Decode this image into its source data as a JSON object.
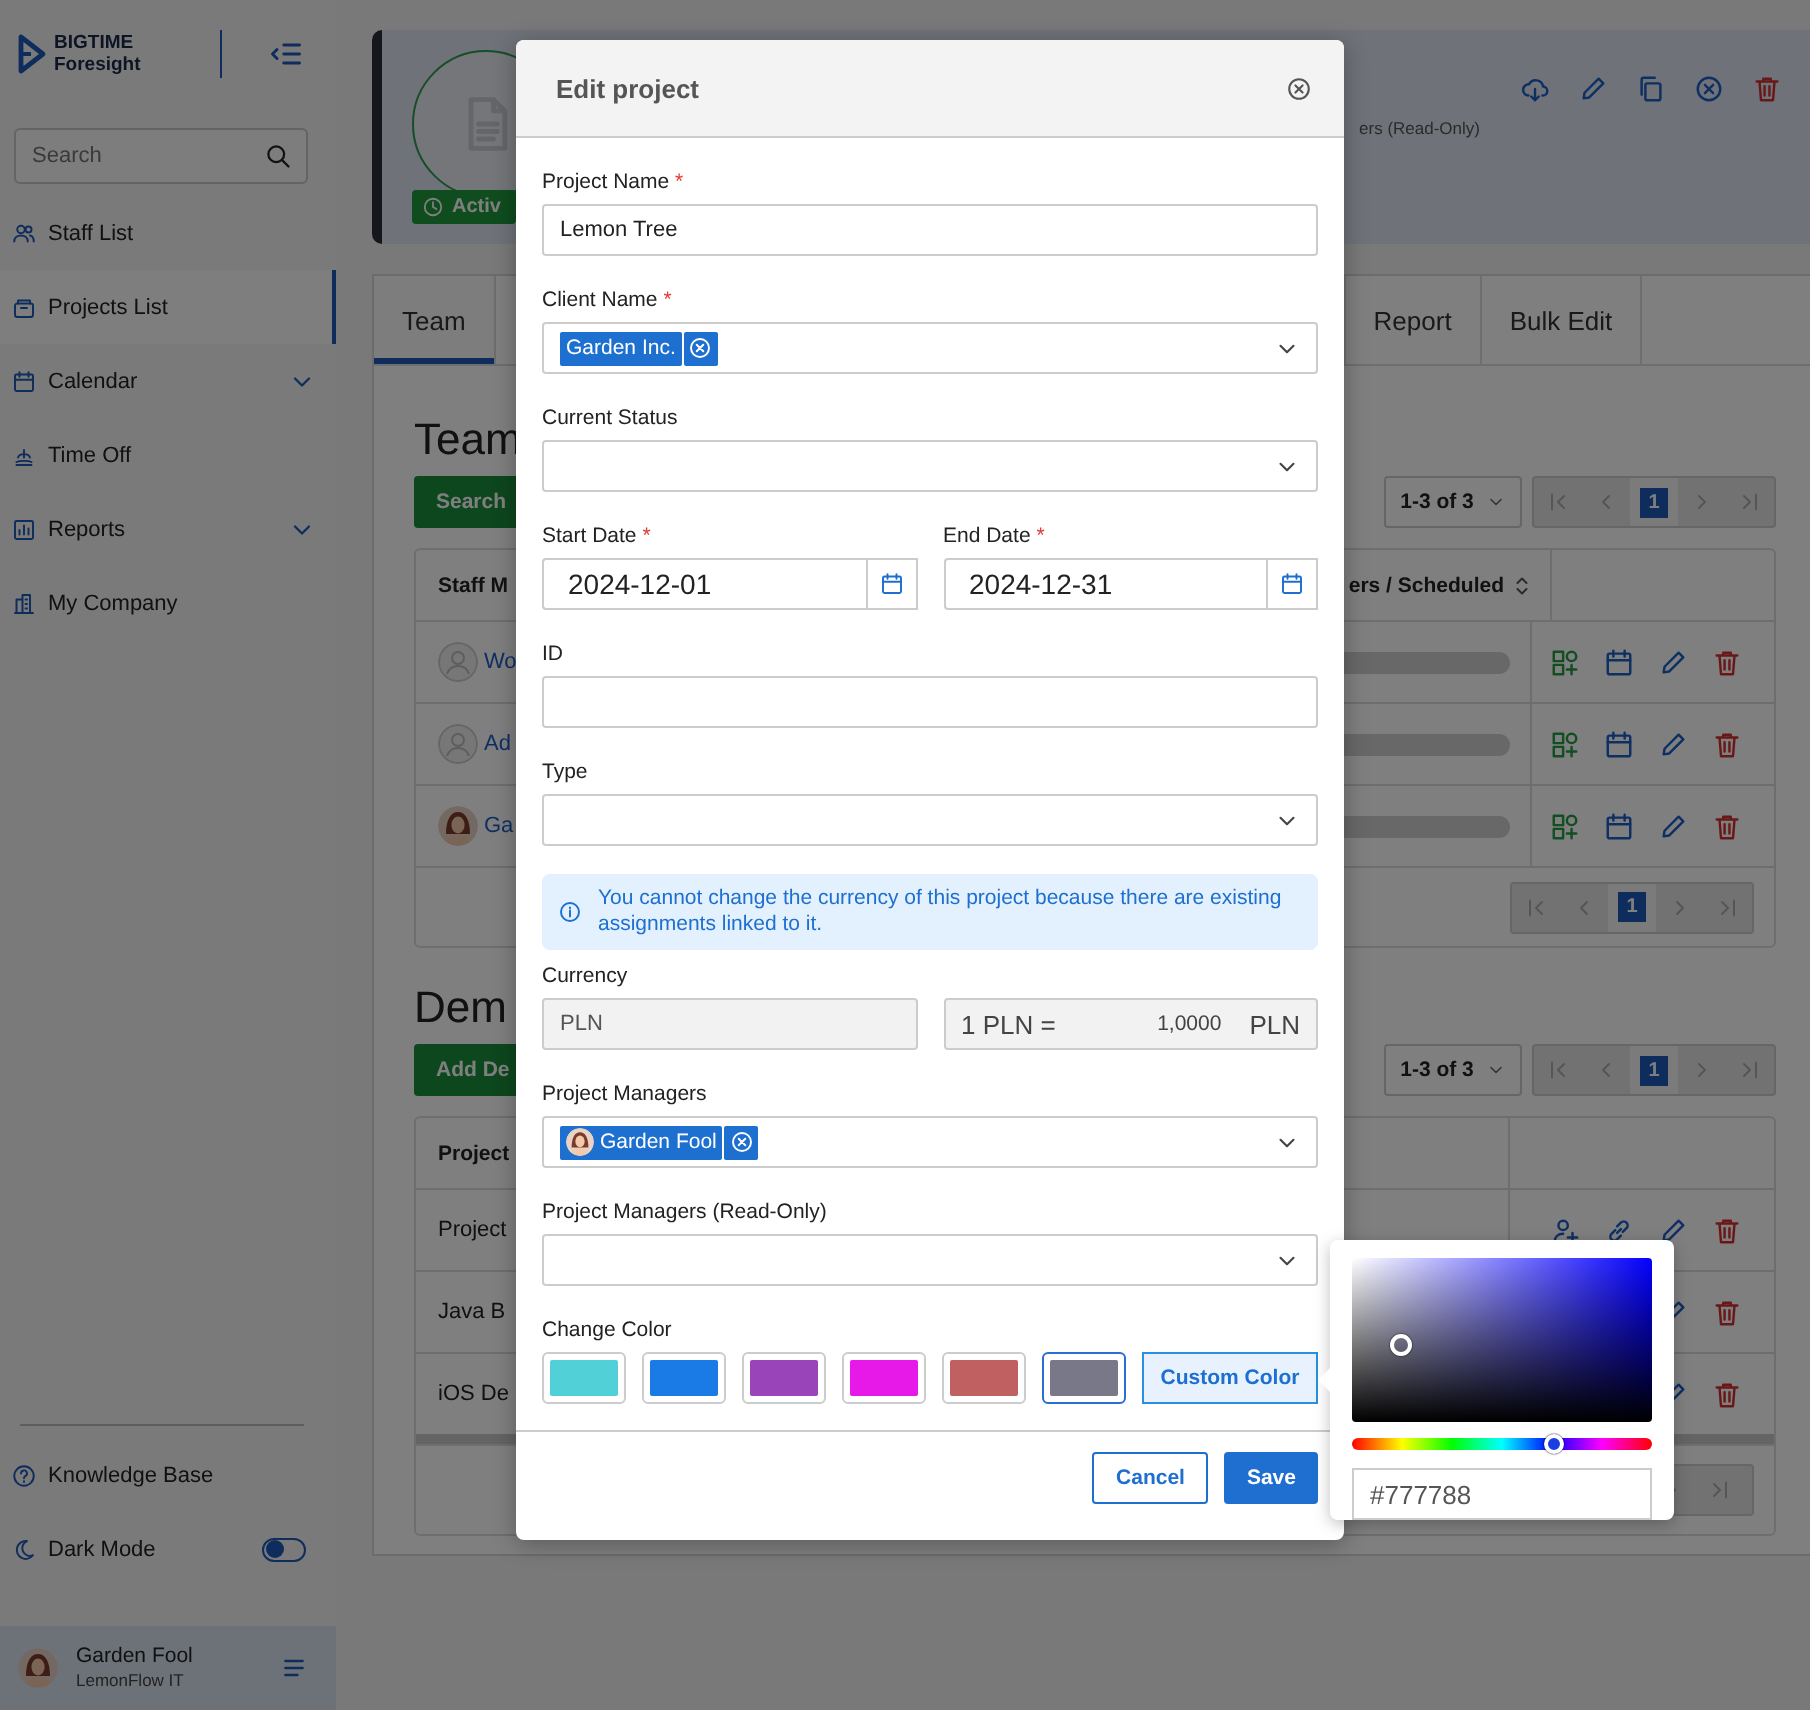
{
  "sidebar": {
    "brand": {
      "name": "BIGTIME",
      "subtitle": "Foresight"
    },
    "search": {
      "placeholder": "Search"
    },
    "nav": [
      {
        "label": "Staff List",
        "selected": false,
        "has_submenu": false
      },
      {
        "label": "Projects List",
        "selected": true,
        "has_submenu": false
      },
      {
        "label": "Calendar",
        "selected": false,
        "has_submenu": true
      },
      {
        "label": "Time Off",
        "selected": false,
        "has_submenu": false
      },
      {
        "label": "Reports",
        "selected": false,
        "has_submenu": true
      },
      {
        "label": "My Company",
        "selected": false,
        "has_submenu": false
      }
    ],
    "help_link": "Knowledge Base",
    "dark_mode": {
      "label": "Dark Mode",
      "on": false
    },
    "user": {
      "name": "Garden Fool",
      "org": "LemonFlow IT"
    }
  },
  "project_header": {
    "status": "Activ",
    "field_label": "ers (Read-Only)"
  },
  "tabs": [
    {
      "label": "Team",
      "selected": true
    },
    {
      "label": "Report",
      "selected": false
    },
    {
      "label": "Bulk Edit",
      "selected": false
    }
  ],
  "team": {
    "heading": "Team",
    "button": "Search",
    "page_range": "1-3 of 3",
    "current_page": "1",
    "columns": [
      "Staff M",
      "ers / Scheduled"
    ],
    "rows": [
      {
        "name": "Wo",
        "kind": "placeholder"
      },
      {
        "name": "Ad",
        "kind": "placeholder"
      },
      {
        "name": "Ga",
        "kind": "photo"
      }
    ],
    "footer_page": "1"
  },
  "demand": {
    "heading": "Dem",
    "button": "Add De",
    "page_range": "1-3 of 3",
    "current_page": "1",
    "columns": [
      "Project"
    ],
    "rows": [
      {
        "name": "Project"
      },
      {
        "name": "Java B"
      },
      {
        "name": "iOS De"
      }
    ]
  },
  "modal": {
    "title": "Edit project",
    "fields": [
      {
        "kind": "text",
        "label": "Project Name",
        "required_mark": "*",
        "value": "Lemon Tree"
      },
      {
        "kind": "select",
        "label": "Client Name",
        "required_mark": "*",
        "chips": [
          {
            "label": "Garden Inc.",
            "avatar": false
          }
        ]
      },
      {
        "kind": "select",
        "label": "Current Status"
      },
      {
        "kind": "dates",
        "items": [
          {
            "label": "Start Date",
            "required_mark": "*",
            "value": "2024-12-01"
          },
          {
            "label": "End Date",
            "required_mark": "*",
            "value": "2024-12-31"
          }
        ]
      },
      {
        "kind": "text",
        "label": "ID"
      },
      {
        "kind": "select",
        "label": "Type"
      },
      {
        "kind": "info",
        "text": "You cannot change the currency of this project because there are existing assignments linked to it."
      },
      {
        "kind": "currency",
        "label": "Currency",
        "value": "PLN",
        "disabled": true,
        "rate_prefix": "1 PLN =",
        "rate": "1,0000",
        "rate_suffix": "PLN"
      },
      {
        "kind": "select",
        "label": "Project Managers",
        "chips": [
          {
            "label": "Garden Fool",
            "avatar": true
          }
        ]
      },
      {
        "kind": "select",
        "label": "Project Managers (Read-Only)"
      },
      {
        "kind": "colors",
        "label": "Change Color",
        "custom_button": "Custom Color",
        "swatches": [
          {
            "color": "#52d0d8",
            "selected": false
          },
          {
            "color": "#1a7ae6",
            "selected": false
          },
          {
            "color": "#9944b8",
            "selected": false
          },
          {
            "color": "#e619e8",
            "selected": false
          },
          {
            "color": "#c06060",
            "selected": false
          },
          {
            "color": "#787888",
            "selected": true
          }
        ]
      }
    ],
    "buttons": [
      {
        "label": "Cancel",
        "kind": "secondary"
      },
      {
        "label": "Save",
        "kind": "primary"
      }
    ]
  },
  "color_picker": {
    "level": 0.67,
    "hex": "#777788"
  }
}
